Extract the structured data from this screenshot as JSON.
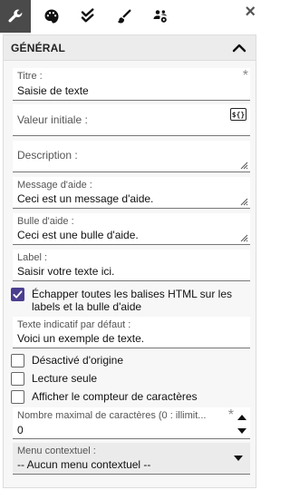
{
  "toolbar": {
    "tabs": [
      {
        "icon": "wrench-icon",
        "active": true
      },
      {
        "icon": "palette-icon",
        "active": false
      },
      {
        "icon": "double-check-icon",
        "active": false
      },
      {
        "icon": "brush-icon",
        "active": false
      },
      {
        "icon": "users-cog-icon",
        "active": false
      }
    ],
    "close_label": "×"
  },
  "section": {
    "title": "GÉNÉRAL"
  },
  "fields": {
    "titre": {
      "label": "Titre :",
      "value": "Saisie de texte",
      "required_mark": "*"
    },
    "valeur_initiale": {
      "label": "Valeur initiale :",
      "value": "",
      "var_button": "${}"
    },
    "description": {
      "label": "Description :",
      "value": ""
    },
    "message_aide": {
      "label": "Message d'aide :",
      "value": "Ceci est un message d'aide."
    },
    "bulle_aide": {
      "label": "Bulle d'aide :",
      "value": "Ceci est une bulle d'aide."
    },
    "label": {
      "label": "Label :",
      "value": "Saisir votre texte ici."
    },
    "texte_indicatif": {
      "label": "Texte indicatif par défaut :",
      "value": "Voici un exemple de texte."
    },
    "nombre_max": {
      "label": "Nombre maximal de caractères (0 : illimit...",
      "value": "0",
      "required_mark": "*"
    },
    "menu_contextuel": {
      "label": "Menu contextuel :",
      "value": "-- Aucun menu contextuel --"
    }
  },
  "checkboxes": {
    "echapper": {
      "label": "Échapper toutes les balises HTML sur les labels et la bulle d'aide",
      "checked": true
    },
    "desactive": {
      "label": "Désactivé d'origine",
      "checked": false
    },
    "lecture_seule": {
      "label": "Lecture seule",
      "checked": false
    },
    "compteur": {
      "label": "Afficher le compteur de caractères",
      "checked": false
    }
  },
  "colors": {
    "accent": "#4b3f8f",
    "active_tab": "#4a4a4a"
  }
}
